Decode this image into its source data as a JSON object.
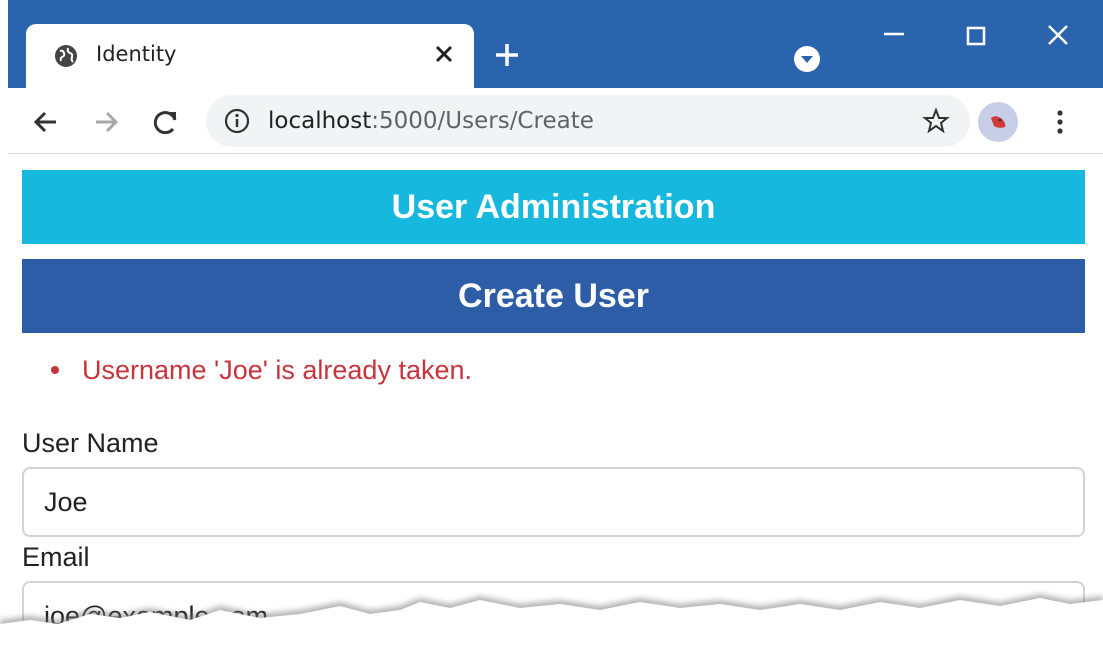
{
  "browser": {
    "tab_title": "Identity",
    "url_host": "localhost",
    "url_path": ":5000/Users/Create",
    "icons": [
      "globe-icon",
      "close-icon",
      "plus-icon",
      "chevron-down-icon",
      "minimize-icon",
      "maximize-icon",
      "close-icon",
      "arrow-left-icon",
      "arrow-right-icon",
      "reload-icon",
      "info-icon",
      "star-icon",
      "avatar-icon",
      "kebab-menu-icon"
    ],
    "chrome_color": "#2a64ad"
  },
  "page": {
    "header_title": "User Administration",
    "subheader_title": "Create User",
    "errors": [
      "Username 'Joe' is already taken."
    ],
    "form": {
      "username_label": "User Name",
      "username_value": "Joe",
      "email_label": "Email",
      "email_value": "joe@example.com"
    }
  },
  "colors": {
    "header_bg": "#17b8dd",
    "subheader_bg": "#2e5da8",
    "error_text": "#c8333c"
  }
}
